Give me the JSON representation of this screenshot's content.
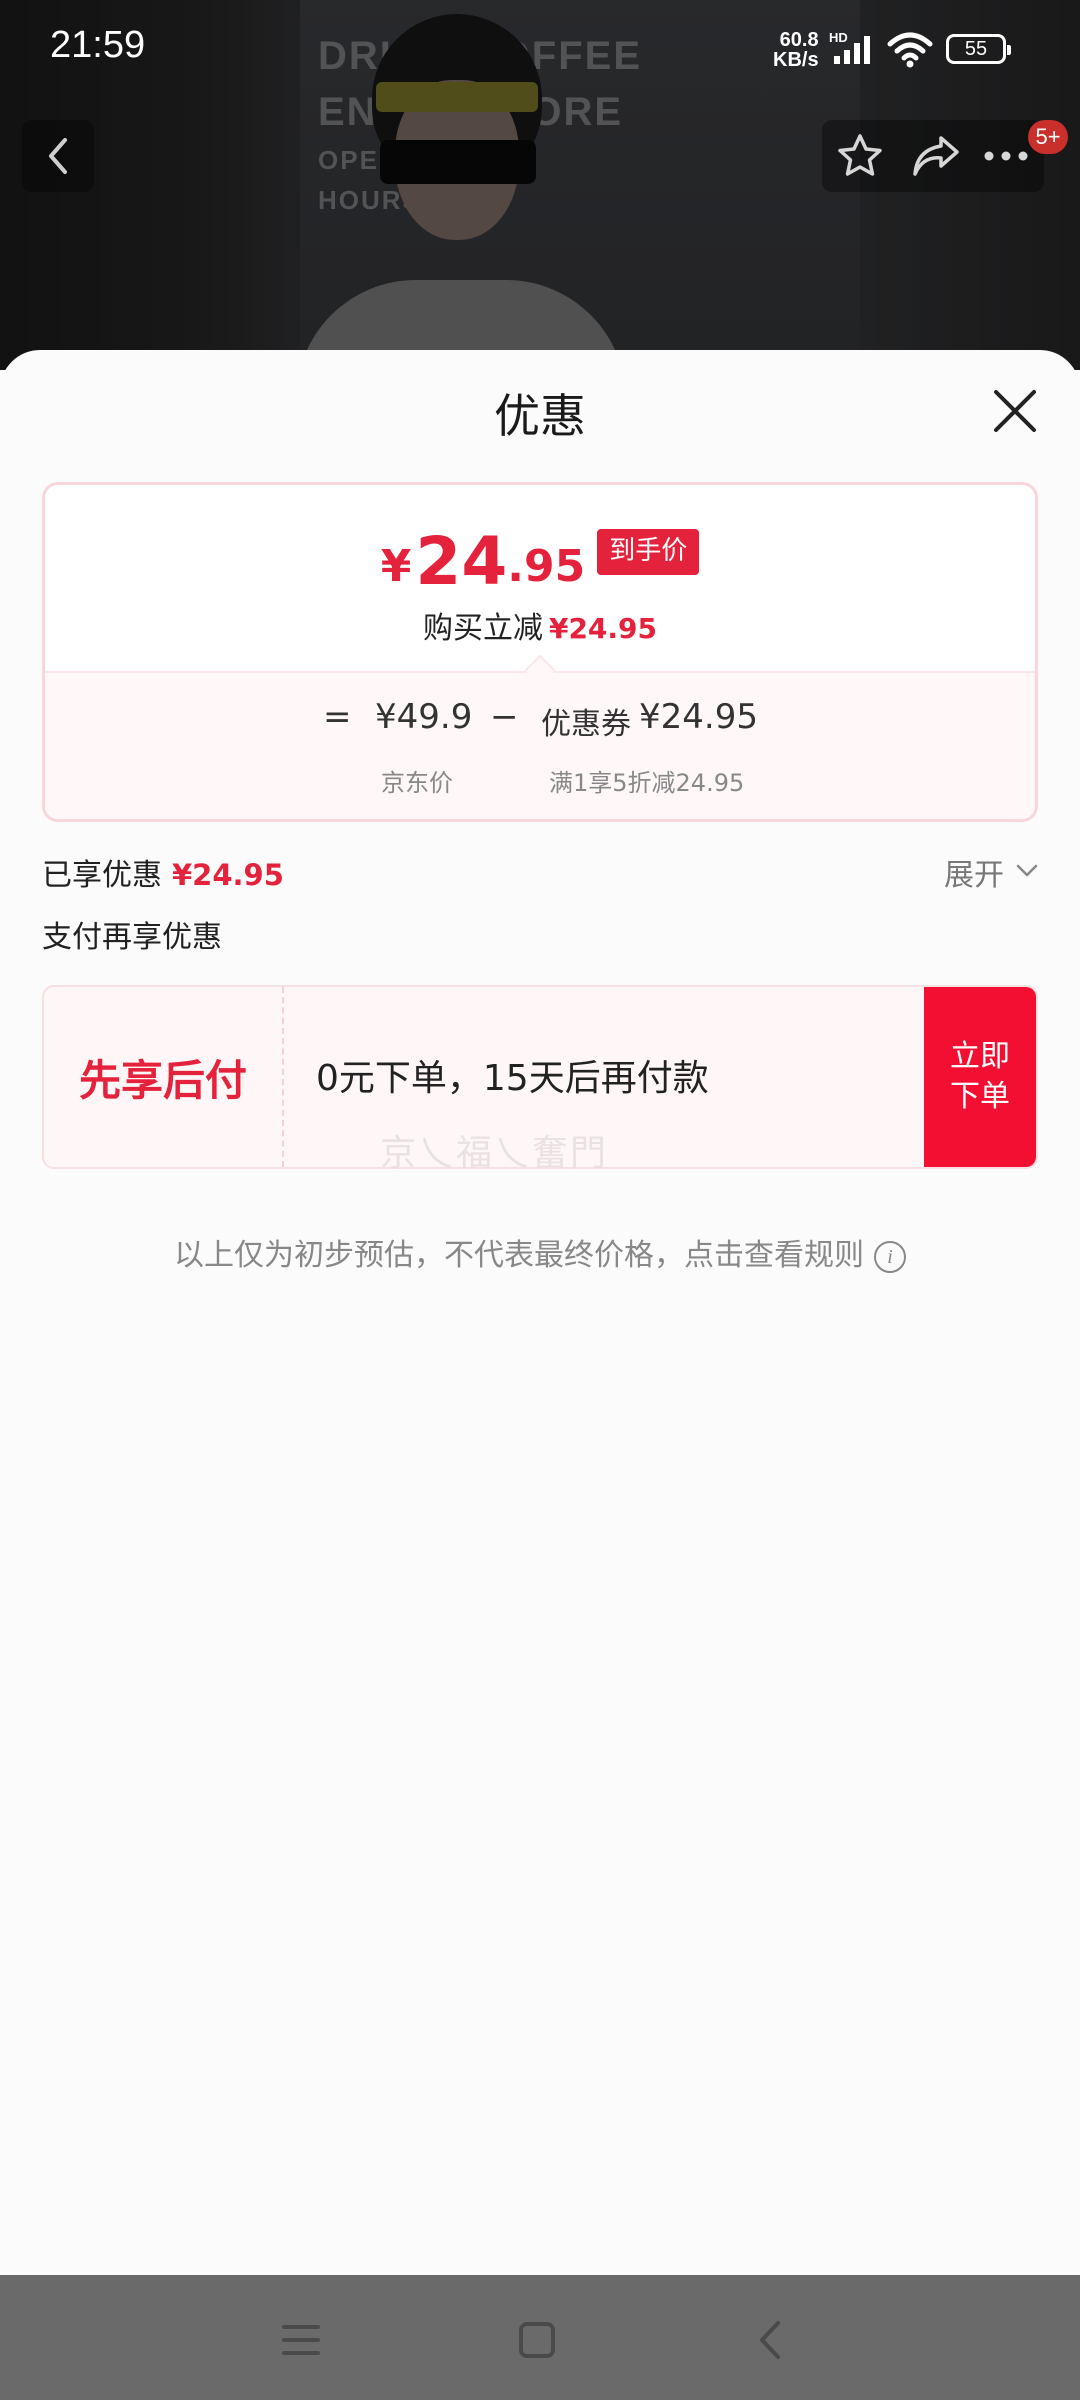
{
  "status_bar": {
    "time": "21:59",
    "net_speed_value": "60.8",
    "net_speed_unit": "KB/s",
    "hd_label": "HD",
    "battery": "55"
  },
  "photo": {
    "store_text_line1": "DRINK COFFEE",
    "store_text_line2": "ENJOY STORE",
    "store_text_line3": "OPEN",
    "store_text_line4": "HOURS"
  },
  "header": {
    "badge": "5+"
  },
  "sheet": {
    "title": "优惠",
    "price": {
      "currency": "¥",
      "integer": "24",
      "decimal": ".95",
      "tag": "到手价",
      "reduce_label": "购买立减",
      "reduce_value": "¥24.95"
    },
    "breakdown": {
      "equals": "=",
      "jd_price": "¥49.9",
      "minus": "−",
      "coupon_label": "优惠券",
      "coupon_value": "¥24.95",
      "jd_price_label": "京东价",
      "coupon_note": "满1享5折减24.95"
    },
    "enjoyed_label": "已享优惠",
    "enjoyed_value": "¥24.95",
    "expand_label": "展开",
    "pay_more_label": "支付再享优惠",
    "bnpl": {
      "title": "先享后付",
      "desc": "0元下单，15天后再付款",
      "button_line1": "立即",
      "button_line2": "下单"
    },
    "watermark": "京乀福乀奮門",
    "notice": "以上仅为初步预估，不代表最终价格，点击查看规则",
    "info_glyph": "i"
  },
  "colors": {
    "accent_red": "#e4223b",
    "button_red": "#f20f31"
  }
}
